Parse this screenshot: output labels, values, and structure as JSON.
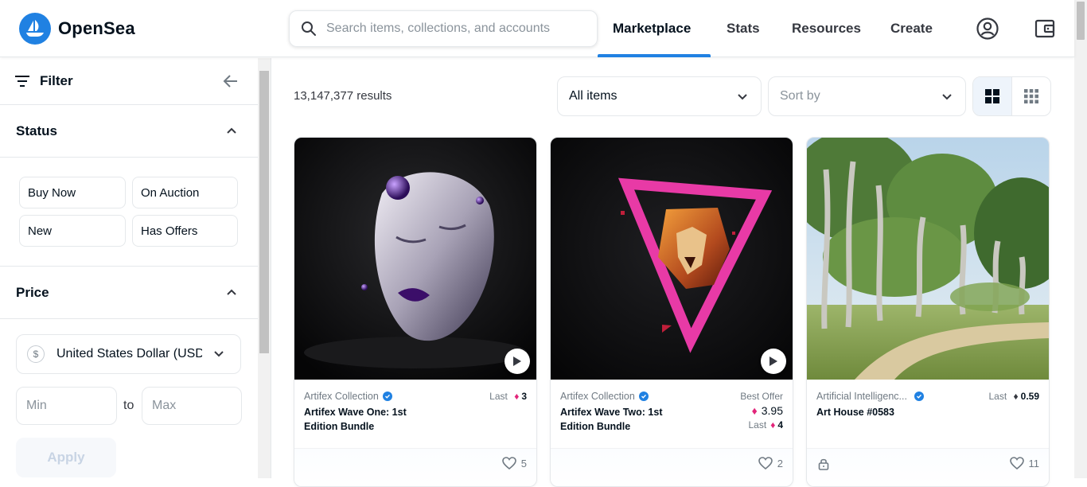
{
  "header": {
    "logo_text": "OpenSea",
    "search_placeholder": "Search items, collections, and accounts",
    "nav": [
      "Marketplace",
      "Stats",
      "Resources",
      "Create"
    ],
    "active_nav": "Marketplace",
    "accent_color": "#2081e2"
  },
  "sidebar": {
    "filter_label": "Filter",
    "status_title": "Status",
    "status_options": [
      "Buy Now",
      "On Auction",
      "New",
      "Has Offers"
    ],
    "price_title": "Price",
    "currency_symbol": "$",
    "currency_value": "United States Dollar (USD)",
    "min_placeholder": "Min",
    "to_label": "to",
    "max_placeholder": "Max",
    "apply_label": "Apply"
  },
  "main": {
    "results_count": "13,147,377 results",
    "items_dropdown": "All items",
    "sort_dropdown": "Sort by",
    "cards": [
      {
        "collection": "Artifex Collection",
        "name": "Artifex Wave One: 1st Edition Bundle",
        "price_label": "Last",
        "price_value": "3",
        "likes": "5",
        "media": "video"
      },
      {
        "collection": "Artifex Collection",
        "name": "Artifex Wave Two: 1st Edition Bundle",
        "price_label": "Best Offer",
        "price_value": "3.95",
        "last_label": "Last",
        "last_value": "4",
        "likes": "2",
        "media": "video"
      },
      {
        "collection": "Artificial Intelligenc...",
        "name": "Art House #0583",
        "price_label": "Last",
        "price_value": "0.59",
        "likes": "11",
        "media": "image"
      }
    ]
  }
}
